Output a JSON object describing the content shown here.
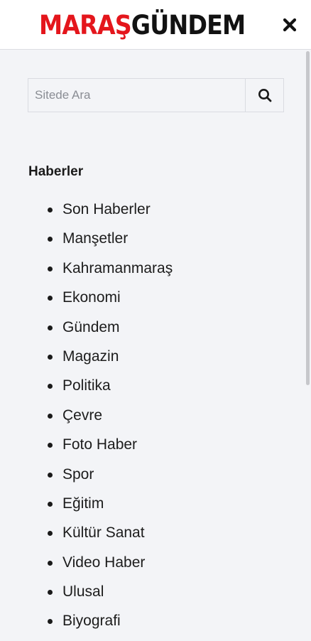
{
  "header": {
    "logo_part1": "MARAŞ",
    "logo_part2": "GÜNDEM",
    "close_icon": "close-icon",
    "brand_color": "#e4161c"
  },
  "search": {
    "placeholder": "Sitede Ara",
    "value": "",
    "button_icon": "search-icon"
  },
  "menu": {
    "section_title": "Haberler",
    "items": [
      {
        "label": "Son Haberler"
      },
      {
        "label": "Manşetler"
      },
      {
        "label": "Kahramanmaraş"
      },
      {
        "label": "Ekonomi"
      },
      {
        "label": "Gündem"
      },
      {
        "label": "Magazin"
      },
      {
        "label": "Politika"
      },
      {
        "label": "Çevre"
      },
      {
        "label": "Foto Haber"
      },
      {
        "label": "Spor"
      },
      {
        "label": "Eğitim"
      },
      {
        "label": "Kültür Sanat"
      },
      {
        "label": "Video Haber"
      },
      {
        "label": "Ulusal"
      },
      {
        "label": "Biyografi"
      }
    ]
  }
}
